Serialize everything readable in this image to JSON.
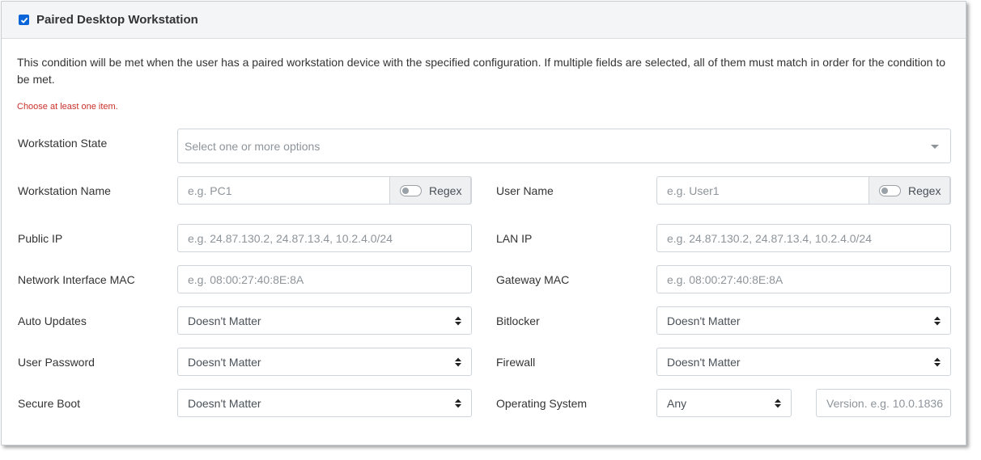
{
  "header": {
    "title": "Paired Desktop Workstation",
    "checked": true
  },
  "description": "This condition will be met when the user has a paired workstation device with the specified configuration. If multiple fields are selected, all of them must match in order for the condition to be met.",
  "error": "Choose at least one item.",
  "workstation_state": {
    "label": "Workstation State",
    "placeholder": "Select one or more options"
  },
  "workstation_name": {
    "label": "Workstation Name",
    "placeholder": "e.g. PC1",
    "regex_label": "Regex"
  },
  "user_name": {
    "label": "User Name",
    "placeholder": "e.g. User1",
    "regex_label": "Regex"
  },
  "public_ip": {
    "label": "Public IP",
    "placeholder": "e.g. 24.87.130.2, 24.87.13.4, 10.2.4.0/24"
  },
  "lan_ip": {
    "label": "LAN IP",
    "placeholder": "e.g. 24.87.130.2, 24.87.13.4, 10.2.4.0/24"
  },
  "network_mac": {
    "label": "Network Interface MAC",
    "placeholder": "e.g. 08:00:27:40:8E:8A"
  },
  "gateway_mac": {
    "label": "Gateway MAC",
    "placeholder": "e.g. 08:00:27:40:8E:8A"
  },
  "auto_updates": {
    "label": "Auto Updates",
    "value": "Doesn't Matter"
  },
  "bitlocker": {
    "label": "Bitlocker",
    "value": "Doesn't Matter"
  },
  "user_password": {
    "label": "User Password",
    "value": "Doesn't Matter"
  },
  "firewall": {
    "label": "Firewall",
    "value": "Doesn't Matter"
  },
  "secure_boot": {
    "label": "Secure Boot",
    "value": "Doesn't Matter"
  },
  "operating_system": {
    "label": "Operating System",
    "value": "Any",
    "version_placeholder": "Version. e.g. 10.0.1836"
  },
  "colors": {
    "accent": "#0a66d8",
    "error": "#c9302c",
    "header_bg": "#f3f5f7"
  }
}
